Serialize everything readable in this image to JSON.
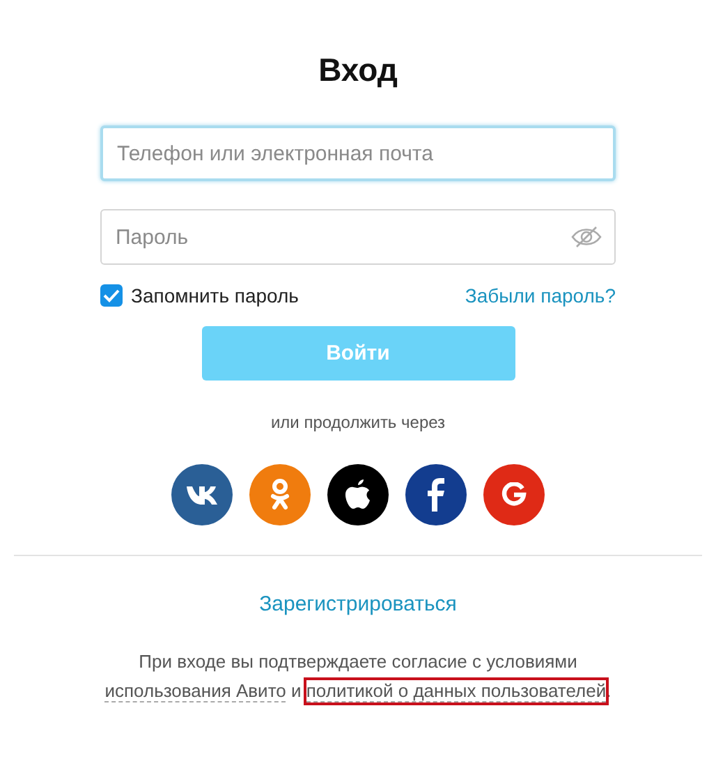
{
  "title": "Вход",
  "login_field": {
    "placeholder": "Телефон или электронная почта",
    "focused": true
  },
  "password_field": {
    "placeholder": "Пароль"
  },
  "remember": {
    "label": "Запомнить пароль",
    "checked": true
  },
  "forgot_link": "Забыли пароль?",
  "submit": {
    "label": "Войти",
    "disabled": true
  },
  "alt_text": "или продолжить через",
  "social": [
    {
      "kind": "vk",
      "color": "#2a5f96"
    },
    {
      "kind": "ok",
      "color": "#f07c0e"
    },
    {
      "kind": "apple",
      "color": "#000000"
    },
    {
      "kind": "facebook",
      "color": "#133d8f"
    },
    {
      "kind": "google",
      "color": "#df2a16"
    }
  ],
  "register_link": "Зарегистрироваться",
  "legal": {
    "text": "При входе вы подтверждаете согласие с условиями",
    "links": [
      {
        "label": "использования Авито",
        "highlighted": false
      },
      {
        "label": "политикой о данных пользователей",
        "highlighted": true
      }
    ],
    "joiner": "и",
    "end": "."
  }
}
